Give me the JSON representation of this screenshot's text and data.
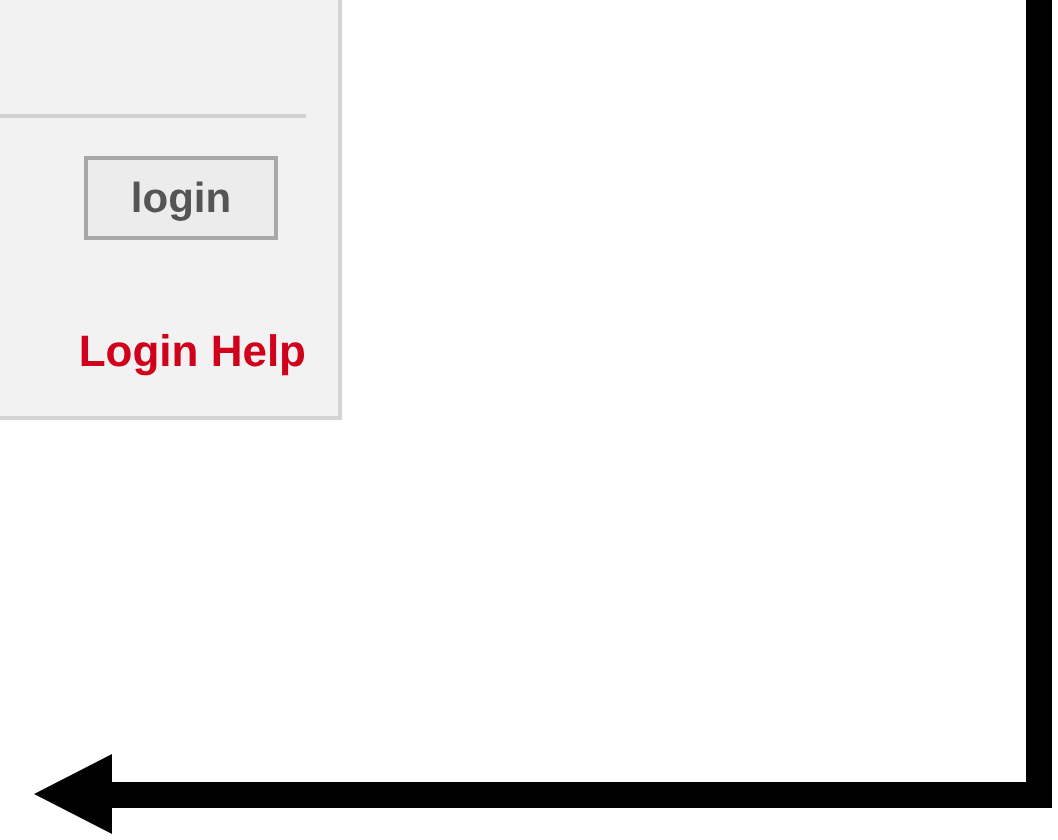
{
  "login_panel": {
    "button": {
      "label": "login"
    },
    "help_link": {
      "label": "Login Help"
    }
  }
}
